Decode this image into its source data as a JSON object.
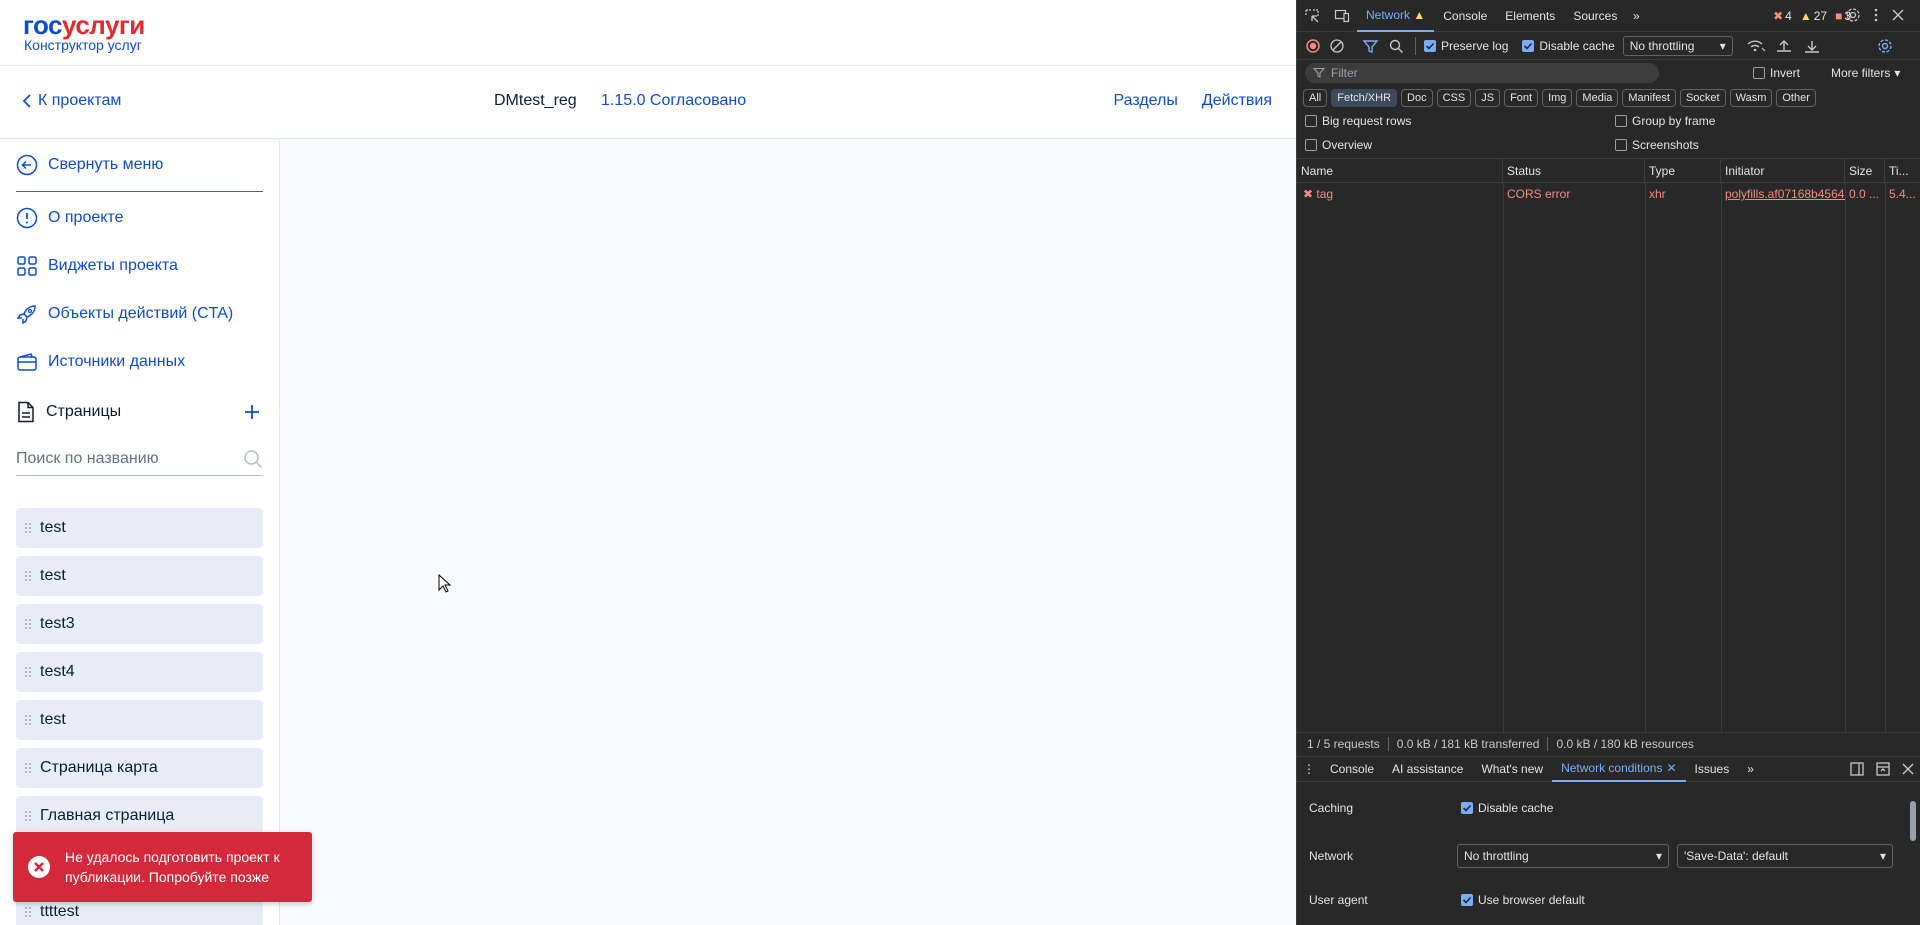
{
  "app": {
    "logo_part1": "гос",
    "logo_part2": "услуги",
    "logo_sub": "Конструктор услуг",
    "back_label": "К проектам",
    "project_name": "DMtest_reg",
    "project_version": "1.15.0 Согласовано",
    "nav_sections": "Разделы",
    "nav_actions": "Действия",
    "menu": {
      "collapse": "Свернуть меню",
      "about": "О проекте",
      "widgets": "Виджеты проекта",
      "cta": "Объекты действий (CTA)",
      "sources": "Источники данных",
      "pages": "Страницы"
    },
    "search_placeholder": "Поиск по названию",
    "pages": [
      "test",
      "test",
      "test3",
      "test4",
      "test",
      "Страница карта",
      "Главная страница",
      "",
      "ttttest"
    ],
    "toast": "Не удалось подготовить проект к публикации. Попробуйте позже"
  },
  "devtools": {
    "tabs": [
      "Network",
      "Console",
      "Elements",
      "Sources"
    ],
    "counts": {
      "errors": "4",
      "warnings": "27",
      "issues": "3"
    },
    "preserve_log": "Preserve log",
    "disable_cache": "Disable cache",
    "throttle": "No throttling",
    "filter_placeholder": "Filter",
    "invert": "Invert",
    "more_filters": "More filters",
    "types": [
      "All",
      "Fetch/XHR",
      "Doc",
      "CSS",
      "JS",
      "Font",
      "Img",
      "Media",
      "Manifest",
      "Socket",
      "Wasm",
      "Other"
    ],
    "options": {
      "big_rows": "Big request rows",
      "group_frame": "Group by frame",
      "overview": "Overview",
      "screenshots": "Screenshots"
    },
    "columns": [
      "Name",
      "Status",
      "Type",
      "Initiator",
      "Size",
      "Ti..."
    ],
    "rows": [
      {
        "name": "tag",
        "status": "CORS error",
        "type": "xhr",
        "initiator": "polyfills.af07168b4564...",
        "size": "0.0 ...",
        "time": "5.4..."
      }
    ],
    "status_bar": [
      "1 / 5 requests",
      "0.0 kB / 181 kB transferred",
      "0.0 kB / 180 kB resources"
    ],
    "drawer_tabs": [
      "Console",
      "AI assistance",
      "What's new",
      "Network conditions",
      "Issues"
    ],
    "conditions": {
      "caching_label": "Caching",
      "caching_value": "Disable cache",
      "network_label": "Network",
      "network_value": "No throttling",
      "save_data": "'Save-Data': default",
      "ua_label": "User agent",
      "ua_value": "Use browser default"
    },
    "colors": {
      "accent": "#7cacf8",
      "error": "#f28b82",
      "warning": "#fdd663"
    }
  }
}
